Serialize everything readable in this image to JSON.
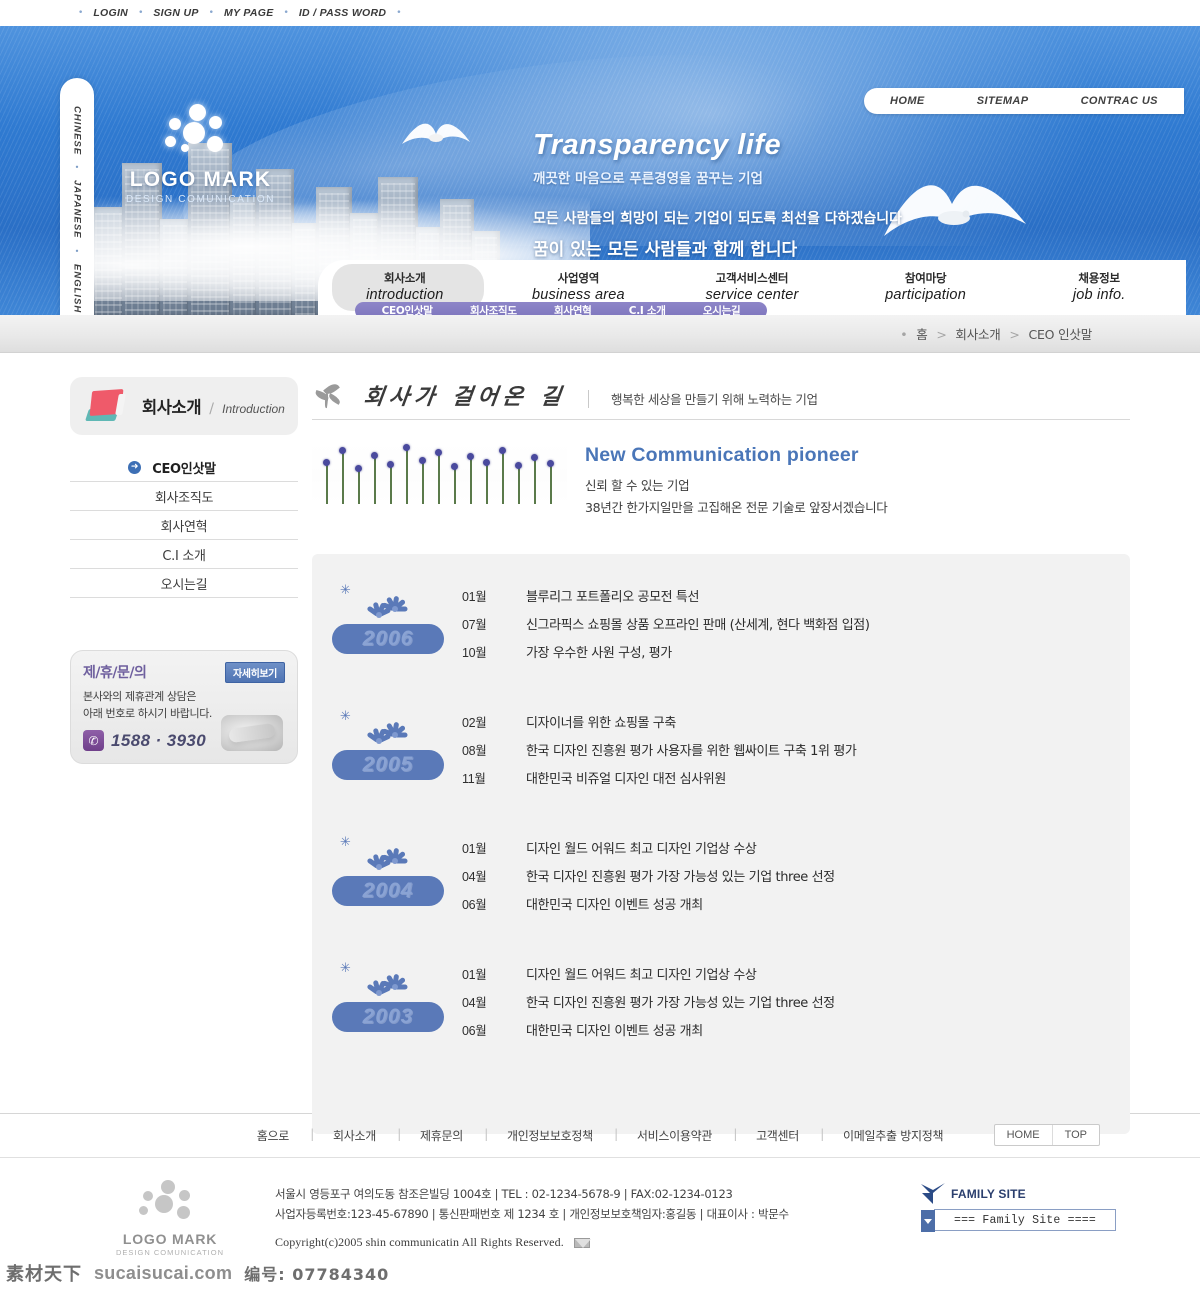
{
  "topbar": {
    "items": [
      "LOGIN",
      "SIGN UP",
      "MY PAGE",
      "ID / PASS WORD"
    ]
  },
  "languages": [
    "CHINESE",
    "JAPANESE",
    "ENGLISH"
  ],
  "logo": {
    "title": "LOGO MARK",
    "subtitle": "DESIGN COMUNICATION"
  },
  "top_right_nav": [
    "HOME",
    "SITEMAP",
    "CONTRAC US"
  ],
  "hero": {
    "title": "Transparency  life",
    "subtitle": "깨끗한 마음으로 푸른경영을 꿈꾸는 기업",
    "line1": "모든 사람들의 희망이 되는 기업이 되도록 최선을 다하겠습니다",
    "line2": "꿈이 있는 모든 사람들과 함께 합니다"
  },
  "mainnav": {
    "items": [
      {
        "ko": "회사소개",
        "en": "introduction",
        "active": true
      },
      {
        "ko": "사업영역",
        "en": "business area",
        "active": false
      },
      {
        "ko": "고객서비스센터",
        "en": "service center",
        "active": false
      },
      {
        "ko": "참여마당",
        "en": "participation",
        "active": false
      },
      {
        "ko": "채용정보",
        "en": "job info.",
        "active": false
      }
    ],
    "submenu": [
      "CEO인삿말",
      "회사조직도",
      "회사연혁",
      "C.I 소개",
      "오시는길"
    ]
  },
  "breadcrumb": {
    "home": "홈",
    "section": "회사소개",
    "page": "CEO 인삿말"
  },
  "sidebar": {
    "header_ko": "회사소개",
    "header_en": "Introduction",
    "items": [
      {
        "label": "CEO인삿말",
        "active": true
      },
      {
        "label": "회사조직도",
        "active": false
      },
      {
        "label": "회사연혁",
        "active": false
      },
      {
        "label": "C.I 소개",
        "active": false
      },
      {
        "label": "오시는길",
        "active": false
      }
    ],
    "promo": {
      "title": "제/휴/문/의",
      "button": "자세히보기",
      "desc_line1": "본사와의 제휴관계 상담은",
      "desc_line2": "아래 번호로 하시기 바랍니다.",
      "phone": "1588 · 3930"
    }
  },
  "page": {
    "title_ko": "회사가 걸어온 길",
    "title_desc": "행복한 세상을 만들기 위해 노력하는 기업",
    "intro_title": "New Communication  pioneer",
    "intro_line1": "신뢰 할 수 있는 기업",
    "intro_line2": "38년간 한가지일만을 고집해온 전문 기술로 앞장서겠습니다"
  },
  "history": [
    {
      "year": "2006",
      "rows": [
        {
          "month": "01월",
          "desc": "블루리그 포트폴리오 공모전 특선"
        },
        {
          "month": "07월",
          "desc": "신그라픽스 쇼핑몰 상품 오프라인 판매 (산세계, 현다 백화점 입점)"
        },
        {
          "month": "10월",
          "desc": "가장 우수한 사원 구성, 평가"
        }
      ]
    },
    {
      "year": "2005",
      "rows": [
        {
          "month": "02월",
          "desc": "디자이너를 위한 쇼핑몰 구축"
        },
        {
          "month": "08월",
          "desc": "한국 디자인 진흥원 평가 사용자를 위한 웹싸이트 구축 1위 평가"
        },
        {
          "month": "11월",
          "desc": "대한민국 비쥬얼 디자인 대전 심사위원"
        }
      ]
    },
    {
      "year": "2004",
      "rows": [
        {
          "month": "01월",
          "desc": "디자인 월드 어워드 최고 디자인 기업상 수상"
        },
        {
          "month": "04월",
          "desc": "한국 디자인 진흥원 평가 가장 가능성 있는 기업 three 선정"
        },
        {
          "month": "06월",
          "desc": "대한민국 디자인 이벤트 성공 개최"
        }
      ]
    },
    {
      "year": "2003",
      "rows": [
        {
          "month": "01월",
          "desc": "디자인 월드 어워드 최고 디자인 기업상 수상"
        },
        {
          "month": "04월",
          "desc": "한국 디자인 진흥원 평가 가장 가능성 있는 기업 three 선정"
        },
        {
          "month": "06월",
          "desc": "대한민국 디자인 이벤트 성공 개최"
        }
      ]
    }
  ],
  "footer": {
    "links": [
      "홈으로",
      "회사소개",
      "제휴문의",
      "개인정보보호정책",
      "서비스이용약관",
      "고객센터",
      "이메일추출 방지정책"
    ],
    "home_label": "HOME",
    "top_label": "TOP",
    "logo_title": "LOGO MARK",
    "logo_sub": "DESIGN COMUNICATION",
    "address_line1": "서울시 영등포구 여의도동 참조은빌딩 1004호  |  TEL : 02-1234-5678-9  |  FAX:02-1234-0123",
    "address_line2": "사업자등록번호:123-45-67890  |  통신판패번호 제 1234 호  |  개인정보보호책임자:홍길동  |  대표이사 : 박문수",
    "copyright": "Copyright(c)2005 shin communicatin All Rights Reserved.",
    "family_title": "FAMILY SITE",
    "family_select": "=== Family Site ===="
  },
  "watermark": {
    "cn": "素材天下",
    "url": "sucaisucai.com",
    "no": "编号: 07784340"
  },
  "colors": {
    "hero_blue": "#2f7ad1",
    "submenu_purple": "#7d74bd",
    "year_badge": "#5a79b8",
    "intro_title": "#4a76b8",
    "accent_red": "#ef5a6a"
  }
}
